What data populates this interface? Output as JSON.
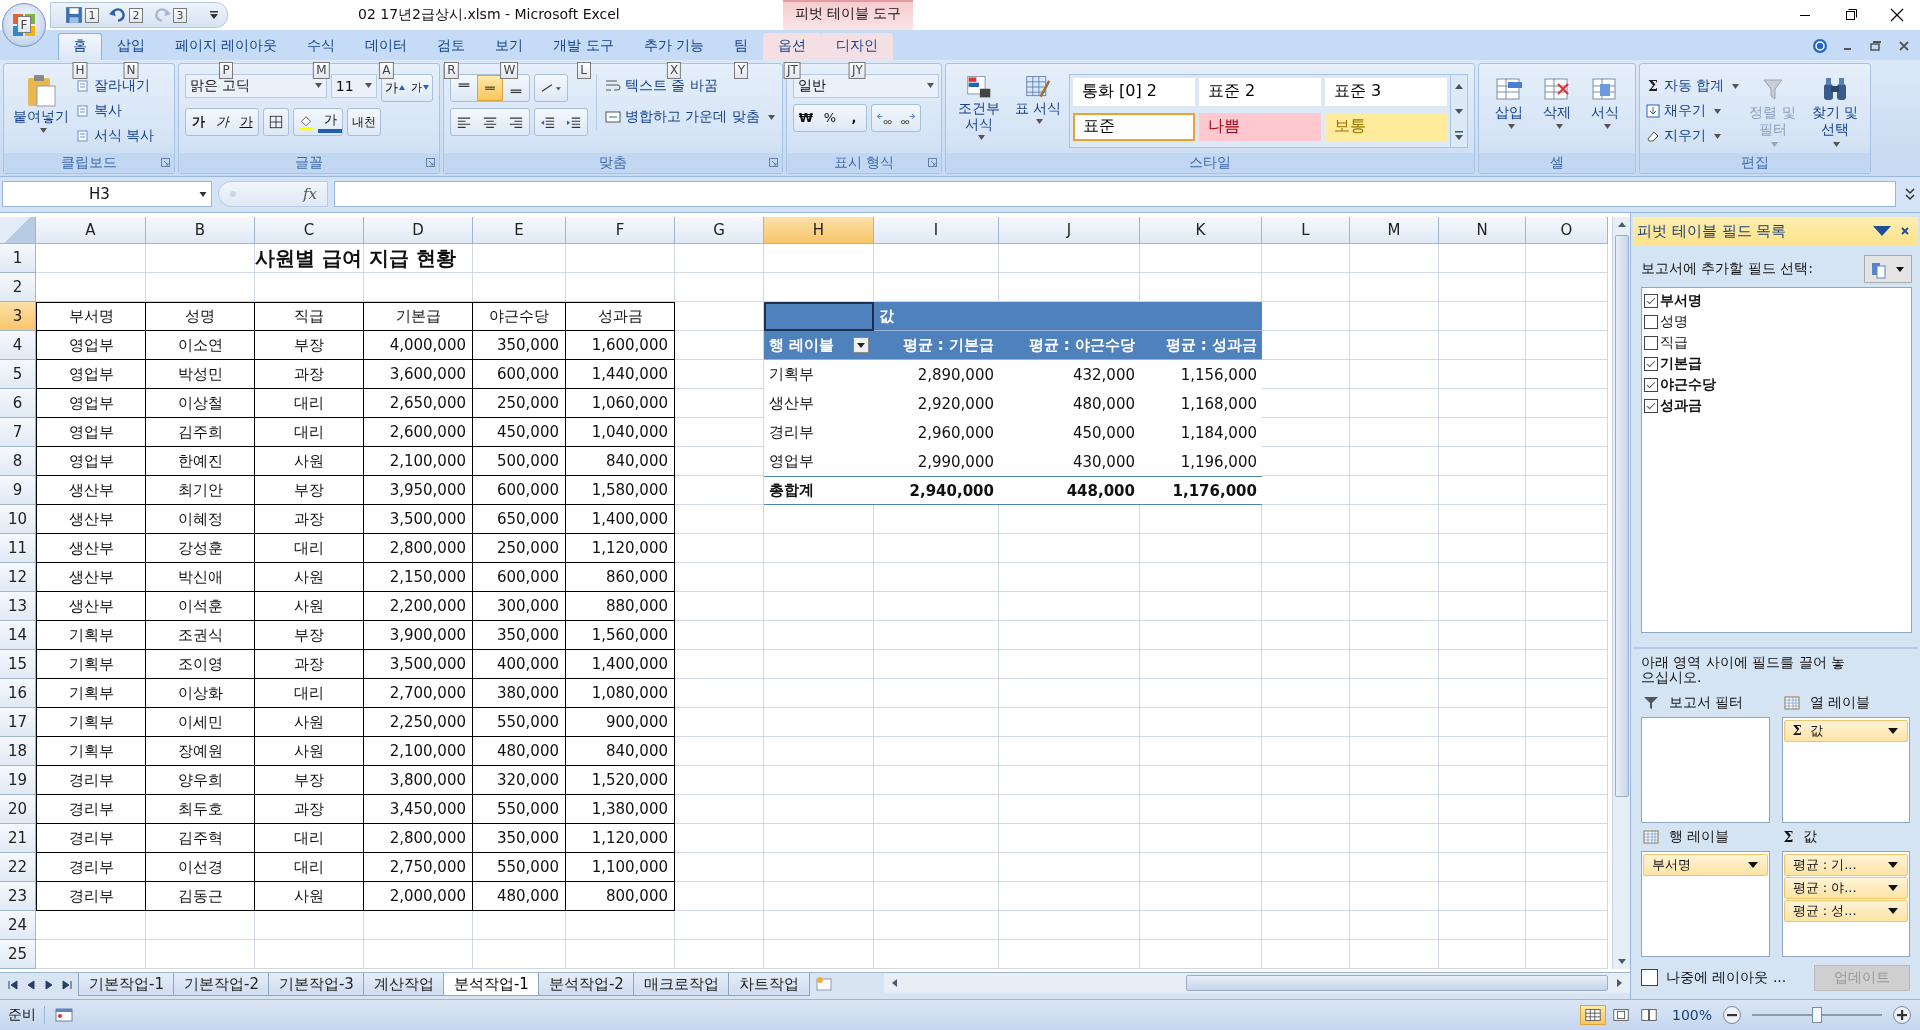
{
  "window": {
    "title": "02 17년2급상시.xlsm - Microsoft Excel",
    "context_group": "피벗 테이블 도구"
  },
  "office_button": {
    "keytip": "F"
  },
  "quick_access": [
    {
      "kind": "save",
      "keytip": "1"
    },
    {
      "kind": "undo",
      "keytip": "2"
    },
    {
      "kind": "redo",
      "keytip": "3"
    }
  ],
  "ribbon_tabs": [
    {
      "label": "홈",
      "keytip": "H",
      "selected": true,
      "contextual": false
    },
    {
      "label": "삽입",
      "keytip": "N",
      "selected": false,
      "contextual": false
    },
    {
      "label": "페이지 레이아웃",
      "keytip": "P",
      "selected": false,
      "contextual": false
    },
    {
      "label": "수식",
      "keytip": "M",
      "selected": false,
      "contextual": false
    },
    {
      "label": "데이터",
      "keytip": "A",
      "selected": false,
      "contextual": false
    },
    {
      "label": "검토",
      "keytip": "R",
      "selected": false,
      "contextual": false
    },
    {
      "label": "보기",
      "keytip": "W",
      "selected": false,
      "contextual": false
    },
    {
      "label": "개발 도구",
      "keytip": "L",
      "selected": false,
      "contextual": false
    },
    {
      "label": "추가 기능",
      "keytip": "X",
      "selected": false,
      "contextual": false
    },
    {
      "label": "팀",
      "keytip": "Y",
      "selected": false,
      "contextual": false
    },
    {
      "label": "옵션",
      "keytip": "JT",
      "selected": false,
      "contextual": true
    },
    {
      "label": "디자인",
      "keytip": "JY",
      "selected": false,
      "contextual": true
    }
  ],
  "ribbon": {
    "clipboard": {
      "title": "클립보드",
      "paste": "붙여넣기",
      "items": [
        "잘라내기",
        "복사",
        "서식 복사"
      ]
    },
    "font": {
      "title": "글꼴",
      "font_name": "맑은 고딕",
      "font_size": "11",
      "grow": "가",
      "shrink": "가",
      "styles": [
        "가",
        "가",
        "가"
      ],
      "font_color": "가",
      "phonetic": "내천"
    },
    "alignment": {
      "title": "맞춤",
      "vertical": [
        {
          "selected": false
        },
        {
          "selected": true
        },
        {
          "selected": false
        }
      ],
      "wrap_text": "텍스트 줄 바꿈",
      "merge_center": "병합하고 가운데 맞춤"
    },
    "number": {
      "title": "표시 형식",
      "format": "일반",
      "currency": "₩",
      "percent": "%",
      "comma": ","
    },
    "styles": {
      "title": "스타일",
      "conditional": "조건부 서식",
      "table_format": "표 서식",
      "cell_styles": [
        {
          "label": "통화 [0] 2",
          "color": "#ffffff",
          "selected": false
        },
        {
          "label": "표준 2",
          "color": "#ffffff",
          "selected": false
        },
        {
          "label": "표준 3",
          "color": "#ffffff",
          "selected": false
        },
        {
          "label": "표준",
          "color": "#ffffff",
          "selected": true
        },
        {
          "label": "나쁨",
          "color": "#ffc7ce",
          "selected": false
        },
        {
          "label": "보통",
          "color": "#ffeb9c",
          "selected": false
        }
      ]
    },
    "cells": {
      "title": "셀",
      "buttons": [
        {
          "kind": "insert",
          "label": "삽입"
        },
        {
          "kind": "delete",
          "label": "삭제"
        },
        {
          "kind": "format",
          "label": "서식"
        }
      ]
    },
    "editing": {
      "title": "편집",
      "items": [
        {
          "kind": "sum",
          "symbol": "Σ",
          "label": "자동 합계"
        },
        {
          "kind": "fill",
          "label": "채우기"
        },
        {
          "kind": "clear",
          "label": "지우기"
        }
      ],
      "sort_filter": {
        "label": "정렬 및 필터",
        "disabled": true
      },
      "find_select": {
        "label": "찾기 및 선택",
        "disabled": false
      }
    }
  },
  "formula_bar": {
    "name_box": "H3",
    "function_label": "fx"
  },
  "sheet": {
    "columns": [
      {
        "label": "A",
        "selected": false
      },
      {
        "label": "B",
        "selected": false
      },
      {
        "label": "C",
        "selected": false
      },
      {
        "label": "D",
        "selected": false
      },
      {
        "label": "E",
        "selected": false
      },
      {
        "label": "F",
        "selected": false
      },
      {
        "label": "G",
        "selected": false
      },
      {
        "label": "H",
        "selected": true
      },
      {
        "label": "I",
        "selected": false
      },
      {
        "label": "J",
        "selected": false
      },
      {
        "label": "K",
        "selected": false
      },
      {
        "label": "L",
        "selected": false
      },
      {
        "label": "M",
        "selected": false
      },
      {
        "label": "N",
        "selected": false
      },
      {
        "label": "O",
        "selected": false
      }
    ],
    "row_numbers": [
      {
        "label": "1",
        "selected": false
      },
      {
        "label": "2",
        "selected": false
      },
      {
        "label": "3",
        "selected": true
      },
      {
        "label": "4",
        "selected": false
      },
      {
        "label": "5",
        "selected": false
      },
      {
        "label": "6",
        "selected": false
      },
      {
        "label": "7",
        "selected": false
      },
      {
        "label": "8",
        "selected": false
      },
      {
        "label": "9",
        "selected": false
      },
      {
        "label": "10",
        "selected": false
      },
      {
        "label": "11",
        "selected": false
      },
      {
        "label": "12",
        "selected": false
      },
      {
        "label": "13",
        "selected": false
      },
      {
        "label": "14",
        "selected": false
      },
      {
        "label": "15",
        "selected": false
      },
      {
        "label": "16",
        "selected": false
      },
      {
        "label": "17",
        "selected": false
      },
      {
        "label": "18",
        "selected": false
      },
      {
        "label": "19",
        "selected": false
      },
      {
        "label": "20",
        "selected": false
      },
      {
        "label": "21",
        "selected": false
      },
      {
        "label": "22",
        "selected": false
      },
      {
        "label": "23",
        "selected": false
      },
      {
        "label": "24",
        "selected": false
      },
      {
        "label": "25",
        "selected": false
      }
    ],
    "title": "사원별 급여 지급 현황",
    "table": {
      "columns": [
        "부서명",
        "성명",
        "직급",
        "기본급",
        "야근수당",
        "성과금"
      ],
      "rows": [
        [
          "영업부",
          "이소연",
          "부장",
          "4,000,000",
          "350,000",
          "1,600,000"
        ],
        [
          "영업부",
          "박성민",
          "과장",
          "3,600,000",
          "600,000",
          "1,440,000"
        ],
        [
          "영업부",
          "이상철",
          "대리",
          "2,650,000",
          "250,000",
          "1,060,000"
        ],
        [
          "영업부",
          "김주희",
          "대리",
          "2,600,000",
          "450,000",
          "1,040,000"
        ],
        [
          "영업부",
          "한예진",
          "사원",
          "2,100,000",
          "500,000",
          "840,000"
        ],
        [
          "생산부",
          "최기안",
          "부장",
          "3,950,000",
          "600,000",
          "1,580,000"
        ],
        [
          "생산부",
          "이혜정",
          "과장",
          "3,500,000",
          "650,000",
          "1,400,000"
        ],
        [
          "생산부",
          "강성훈",
          "대리",
          "2,800,000",
          "250,000",
          "1,120,000"
        ],
        [
          "생산부",
          "박신애",
          "사원",
          "2,150,000",
          "600,000",
          "860,000"
        ],
        [
          "생산부",
          "이석훈",
          "사원",
          "2,200,000",
          "300,000",
          "880,000"
        ],
        [
          "기획부",
          "조권식",
          "부장",
          "3,900,000",
          "350,000",
          "1,560,000"
        ],
        [
          "기획부",
          "조이영",
          "과장",
          "3,500,000",
          "400,000",
          "1,400,000"
        ],
        [
          "기획부",
          "이상화",
          "대리",
          "2,700,000",
          "380,000",
          "1,080,000"
        ],
        [
          "기획부",
          "이세민",
          "사원",
          "2,250,000",
          "550,000",
          "900,000"
        ],
        [
          "기획부",
          "장예원",
          "사원",
          "2,100,000",
          "480,000",
          "840,000"
        ],
        [
          "경리부",
          "양우희",
          "부장",
          "3,800,000",
          "320,000",
          "1,520,000"
        ],
        [
          "경리부",
          "최두호",
          "과장",
          "3,450,000",
          "550,000",
          "1,380,000"
        ],
        [
          "경리부",
          "김주혁",
          "대리",
          "2,800,000",
          "350,000",
          "1,120,000"
        ],
        [
          "경리부",
          "이선경",
          "대리",
          "2,750,000",
          "550,000",
          "1,100,000"
        ],
        [
          "경리부",
          "김동근",
          "사원",
          "2,000,000",
          "480,000",
          "800,000"
        ]
      ]
    },
    "pivot": {
      "values_header": "값",
      "row_label_header": "행 레이블",
      "columns": [
        "평균 : 기본급",
        "평균 : 야근수당",
        "평균 : 성과금"
      ],
      "rows": [
        {
          "label": "기획부",
          "values": [
            "2,890,000",
            "432,000",
            "1,156,000"
          ]
        },
        {
          "label": "생산부",
          "values": [
            "2,920,000",
            "480,000",
            "1,168,000"
          ]
        },
        {
          "label": "경리부",
          "values": [
            "2,960,000",
            "450,000",
            "1,184,000"
          ]
        },
        {
          "label": "영업부",
          "values": [
            "2,990,000",
            "430,000",
            "1,196,000"
          ]
        }
      ],
      "total": {
        "label": "총합계",
        "values": [
          "2,940,000",
          "448,000",
          "1,176,000"
        ]
      }
    }
  },
  "field_list": {
    "title": "피벗 테이블 필드 목록",
    "prompt": "보고서에 추가할 필드 선택:",
    "fields": [
      {
        "label": "부서명",
        "checked": true
      },
      {
        "label": "성명",
        "checked": false
      },
      {
        "label": "직급",
        "checked": false
      },
      {
        "label": "기본급",
        "checked": true
      },
      {
        "label": "야근수당",
        "checked": true
      },
      {
        "label": "성과금",
        "checked": true
      }
    ],
    "drag_hint": "아래 영역 사이에 필드를 끌어 놓으십시오.",
    "areas": [
      {
        "kind": "filter",
        "title": "보고서 필터"
      },
      {
        "kind": "columns",
        "title": "열 레이블",
        "items": [
          {
            "symbol": "Σ",
            "label": "값"
          }
        ]
      },
      {
        "kind": "rows",
        "title": "행 레이블",
        "items": [
          {
            "label": "부서명"
          }
        ]
      },
      {
        "kind": "values",
        "symbol": "Σ",
        "title": "값",
        "items": [
          {
            "label": "평균 : 기..."
          },
          {
            "label": "평균 : 야..."
          },
          {
            "label": "평균 : 성..."
          }
        ]
      }
    ],
    "defer_update": {
      "label": "나중에 레이아웃 ...",
      "checked": false
    },
    "update_button": {
      "label": "업데이트",
      "disabled": true
    }
  },
  "sheet_tabs": [
    {
      "label": "기본작업-1",
      "selected": false
    },
    {
      "label": "기본작업-2",
      "selected": false
    },
    {
      "label": "기본작업-3",
      "selected": false
    },
    {
      "label": "계산작업",
      "selected": false
    },
    {
      "label": "분석작업-1",
      "selected": true
    },
    {
      "label": "분석작업-2",
      "selected": false
    },
    {
      "label": "매크로작업",
      "selected": false
    },
    {
      "label": "차트작업",
      "selected": false
    }
  ],
  "status_bar": {
    "mode": "준비",
    "view_buttons": [
      {
        "kind": "normal",
        "selected": true
      },
      {
        "kind": "layout",
        "selected": false
      },
      {
        "kind": "break",
        "selected": false
      }
    ],
    "zoom": "100%",
    "zoom_slider": {
      "level": 0.5
    }
  }
}
